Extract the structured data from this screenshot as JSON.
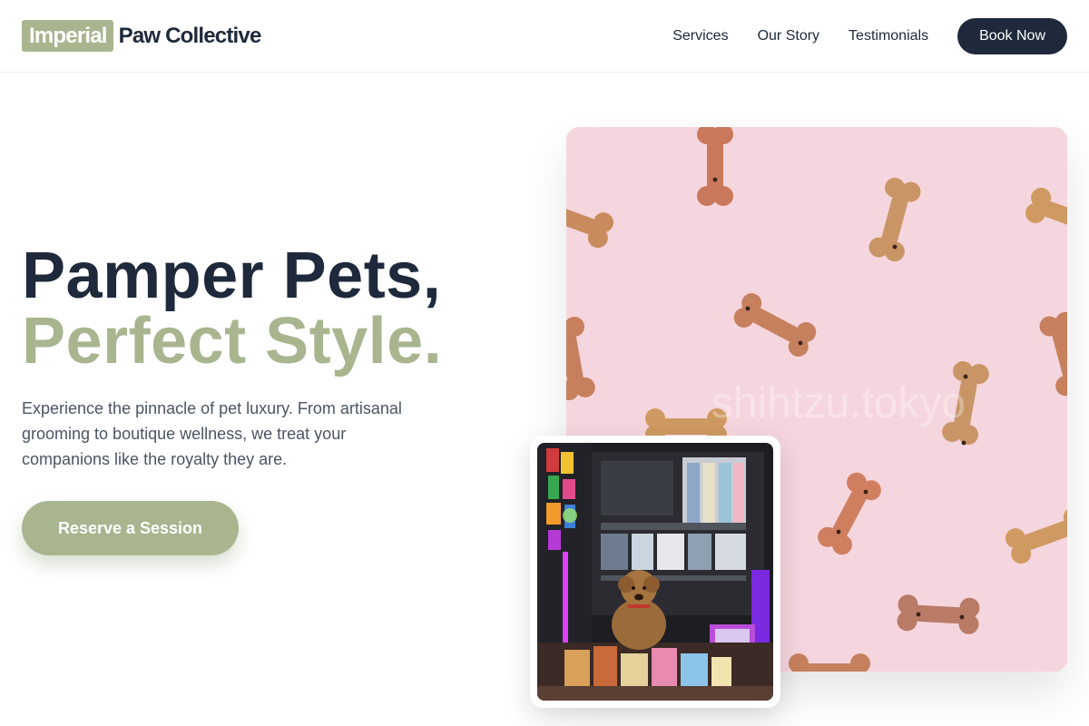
{
  "brand": {
    "badge": "Imperial",
    "name": "Paw Collective"
  },
  "nav": {
    "links": [
      "Services",
      "Our Story",
      "Testimonials"
    ],
    "cta": "Book Now"
  },
  "hero": {
    "title_line1": "Pamper Pets,",
    "title_line2": "Perfect Style.",
    "description": "Experience the pinnacle of pet luxury. From artisanal grooming to boutique wellness, we treat your companions like the royalty they are.",
    "cta": "Reserve a Session"
  },
  "images": {
    "main_watermark": "shihtzu.tokyo"
  },
  "colors": {
    "accent": "#a8b58f",
    "dark": "#1e293b",
    "pink_bg": "#f6d6de"
  }
}
